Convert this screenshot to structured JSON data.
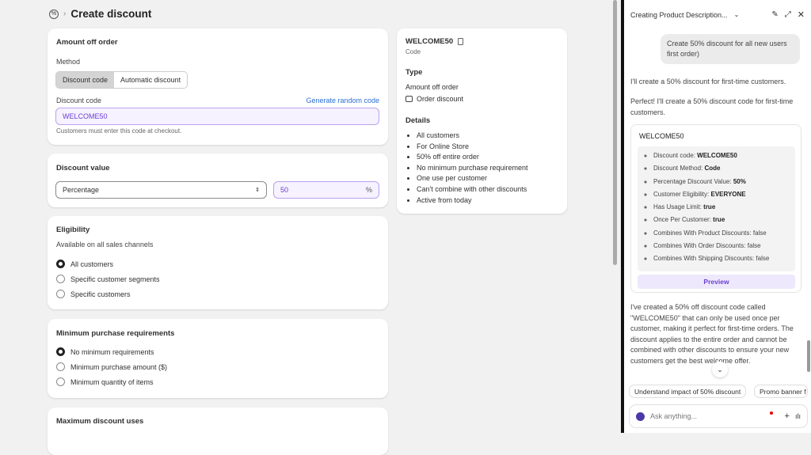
{
  "header": {
    "title": "Create discount"
  },
  "amount_card": {
    "title": "Amount off order",
    "method_label": "Method",
    "method_options": [
      "Discount code",
      "Automatic discount"
    ],
    "code_label": "Discount code",
    "generate_link": "Generate random code",
    "code_value": "WELCOME50",
    "help": "Customers must enter this code at checkout."
  },
  "value_card": {
    "title": "Discount value",
    "type": "Percentage",
    "amount": "50",
    "suffix": "%"
  },
  "eligibility": {
    "title": "Eligibility",
    "subtitle": "Available on all sales channels",
    "options": [
      "All customers",
      "Specific customer segments",
      "Specific customers"
    ]
  },
  "minimum": {
    "title": "Minimum purchase requirements",
    "options": [
      "No minimum requirements",
      "Minimum purchase amount ($)",
      "Minimum quantity of items"
    ]
  },
  "maximum": {
    "title": "Maximum discount uses"
  },
  "summary": {
    "code": "WELCOME50",
    "code_sub": "Code",
    "type_title": "Type",
    "type_value": "Amount off order",
    "type_sub": "Order discount",
    "details_title": "Details",
    "details": [
      "All customers",
      "For Online Store",
      "50% off entire order",
      "No minimum purchase requirement",
      "One use per customer",
      "Can't combine with other discounts",
      "Active from today"
    ]
  },
  "chat": {
    "title": "Creating Product Description...",
    "user_msg": "Create 50% discount for all new users first order)",
    "reply1": "I'll create a 50% discount for first-time customers.",
    "reply2": "Perfect! I'll create a 50% discount code for first-time customers.",
    "card_title": "WELCOME50",
    "fields": [
      {
        "k": "Discount code:",
        "v": "WELCOME50",
        "bold": true
      },
      {
        "k": "Discount Method:",
        "v": "Code",
        "bold": true
      },
      {
        "k": "Percentage Discount Value:",
        "v": "50%",
        "bold": true
      },
      {
        "k": "Customer Eligibility:",
        "v": "EVERYONE",
        "bold": true
      },
      {
        "k": "Has Usage Limit:",
        "v": "true",
        "bold": true
      },
      {
        "k": "Once Per Customer:",
        "v": "true",
        "bold": true
      },
      {
        "k": "Combines With Product Discounts:",
        "v": "false"
      },
      {
        "k": "Combines With Order Discounts:",
        "v": "false"
      },
      {
        "k": "Combines With Shipping Discounts:",
        "v": "false"
      }
    ],
    "preview": "Preview",
    "reply3": "I've created a 50% off discount code called \"WELCOME50\" that can only be used once per customer, making it perfect for first-time orders. The discount applies to the entire order and cannot be combined with other discounts to ensure your new customers get the best welcome offer.",
    "suggestions": [
      "Understand impact of 50% discount",
      "Promo banner f"
    ],
    "input_placeholder": "Ask anything...",
    "accent": "#6b3fd4"
  }
}
